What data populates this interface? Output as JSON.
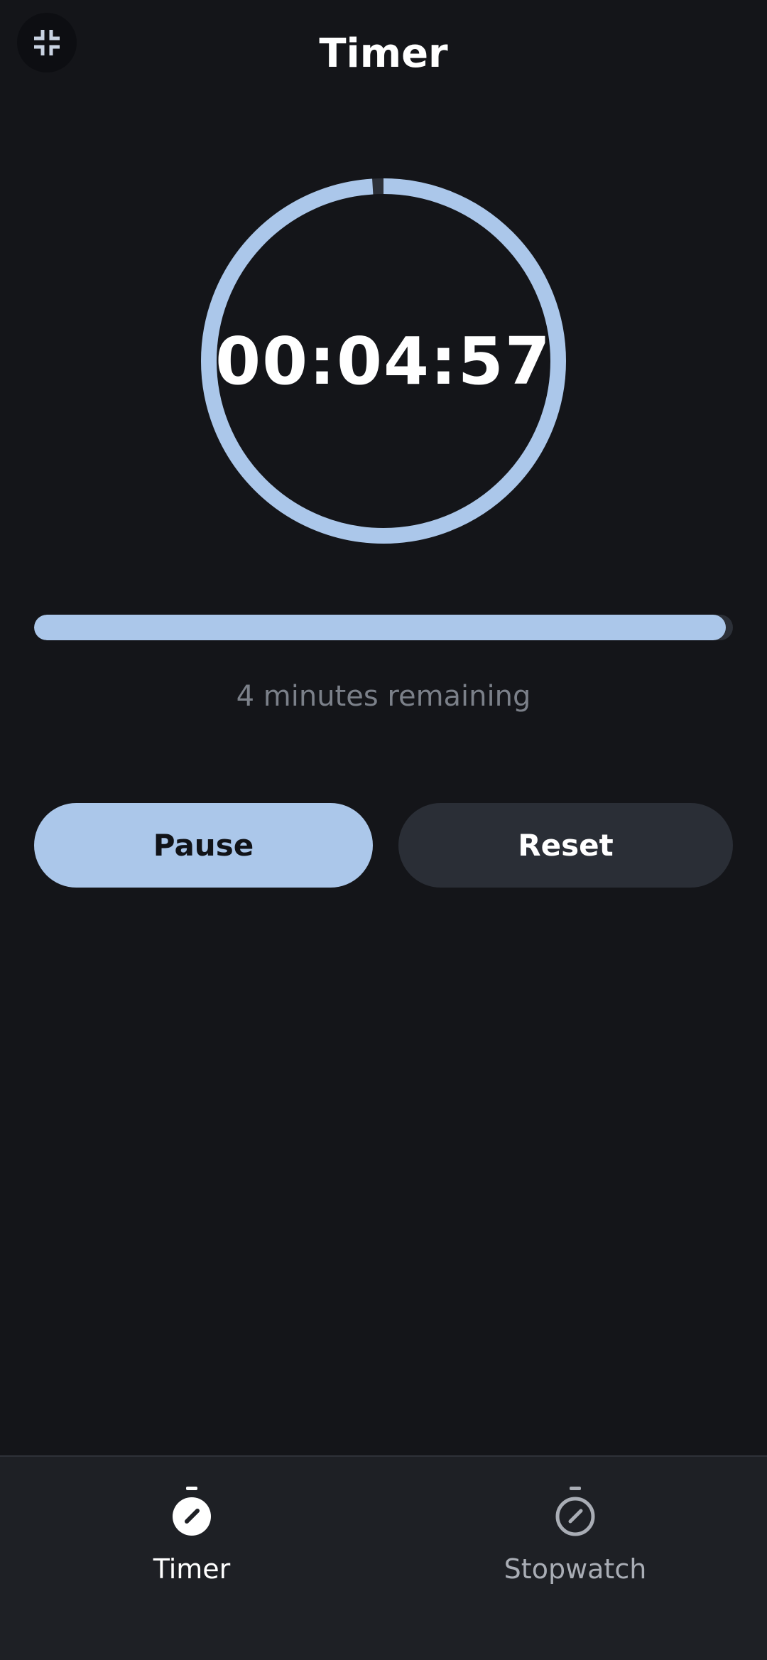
{
  "header": {
    "title": "Timer",
    "exit_fullscreen_icon": "exit-fullscreen-icon"
  },
  "timer": {
    "display": "00:04:57",
    "remaining_text": "4 minutes remaining",
    "progress_fraction": 0.99,
    "ring_fraction": 0.99
  },
  "controls": {
    "pause_label": "Pause",
    "reset_label": "Reset"
  },
  "nav": {
    "items": [
      {
        "label": "Timer",
        "icon": "timer-icon",
        "active": true
      },
      {
        "label": "Stopwatch",
        "icon": "stopwatch-icon",
        "active": false
      }
    ]
  },
  "colors": {
    "background": "#141519",
    "accent": "#abc7ea",
    "track": "#2c3038",
    "secondary_button": "#2a2e36",
    "muted_text": "#7b8089",
    "nav_background": "#1e2025"
  }
}
